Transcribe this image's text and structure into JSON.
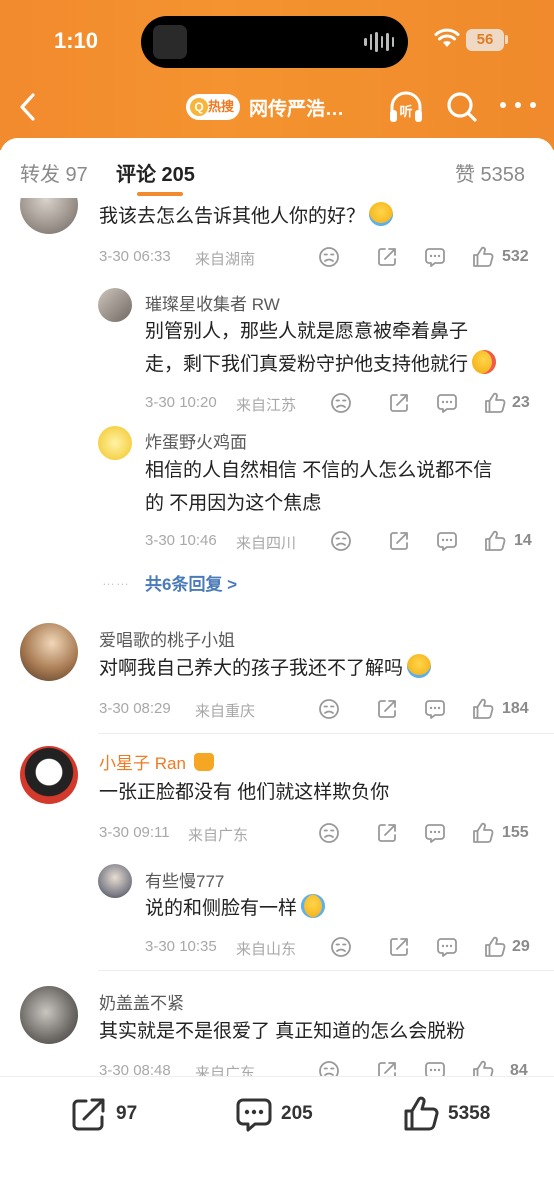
{
  "status_bar": {
    "time": "1:10",
    "battery": "56"
  },
  "nav": {
    "hot_badge": "热搜",
    "title": "网传严浩…",
    "listen_label": "听"
  },
  "tabs": [
    {
      "label": "转发 97"
    },
    {
      "label": "评论 205"
    },
    {
      "label": "赞 5358"
    }
  ],
  "comments": [
    {
      "text": "我该去怎么告诉其他人你的好？",
      "date": "3-30 06:33",
      "location": "来自湖南",
      "likes": "532"
    },
    {
      "name": "璀璨星收集者 RW",
      "text_lines": [
        "别管别人，那些人就是愿意被牵着鼻子",
        "走，剩下我们真爱粉守护他支持他就行"
      ],
      "date": "3-30 10:20",
      "location": "来自江苏",
      "likes": "23"
    },
    {
      "name": "炸蛋野火鸡面",
      "text_lines": [
        "相信的人自然相信 不信的人怎么说都不信",
        "的 不用因为这个焦虑"
      ],
      "date": "3-30 10:46",
      "location": "来自四川",
      "likes": "14"
    },
    {
      "more_replies": "共6条回复 >"
    },
    {
      "name": "爱唱歌的桃子小姐",
      "text": "对啊我自己养大的孩子我还不了解吗",
      "date": "3-30 08:29",
      "location": "来自重庆",
      "likes": "184"
    },
    {
      "name": "小星子 Ran",
      "text": "一张正脸都没有 他们就这样欺负你",
      "date": "3-30 09:11",
      "location": "来自广东",
      "likes": "155"
    },
    {
      "name": "有些慢777",
      "text": "说的和侧脸有一样",
      "date": "3-30 10:35",
      "location": "来自山东",
      "likes": "29"
    },
    {
      "name": "奶盖盖不紧",
      "text": "其实就是不是很爱了 真正知道的怎么会脱粉",
      "date": "3-30 08:48",
      "location": "来自广东",
      "likes": "84"
    }
  ],
  "bottom_bar": {
    "reposts": "97",
    "comments": "205",
    "likes": "5358"
  },
  "colors": {
    "accent": "#f28a2e",
    "link": "#4a7ab8"
  }
}
